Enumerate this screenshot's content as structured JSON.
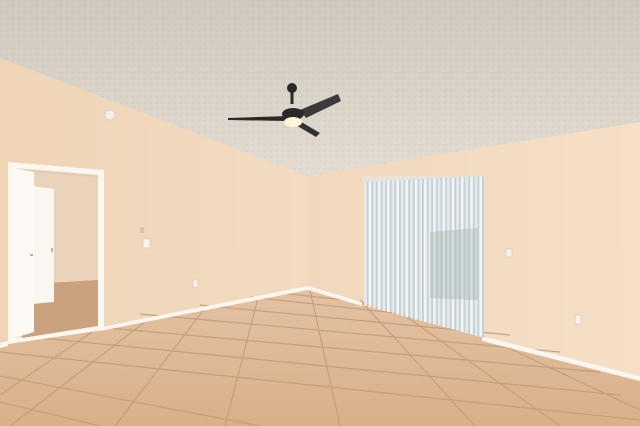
{
  "scene": {
    "description_tag": "empty-room-photo",
    "watermark_text": "",
    "colors": {
      "ceiling": "#d6d0c6",
      "left_wall": "#f0d8bd",
      "right_wall": "#f3dcc2",
      "floor": "#ddb996",
      "grout": "#c9a27e",
      "baseboard": "#fbf6ef",
      "door_frame": "#fbf7f1",
      "hallway": "#e7d1b7",
      "blinds": "#f4f4f2",
      "window_light": "#c9d7df",
      "fan_dark": "#2a2a2a",
      "fan_light": "#fff7e0"
    }
  }
}
